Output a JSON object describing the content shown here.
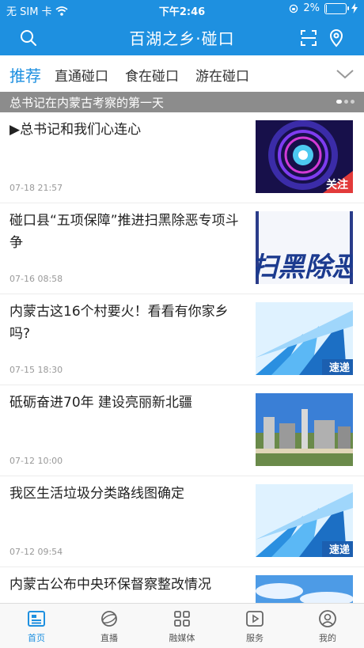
{
  "status_bar": {
    "carrier": "无 SIM 卡",
    "time": "下午2:46",
    "battery": "2%",
    "battery_level": 0.02
  },
  "header": {
    "title": "百湖之乡·碰口"
  },
  "tabs": {
    "items": [
      {
        "label": "推荐",
        "active": true
      },
      {
        "label": "直通碰口",
        "active": false
      },
      {
        "label": "食在碰口",
        "active": false
      },
      {
        "label": "游在碰口",
        "active": false
      }
    ]
  },
  "banner": {
    "text": "总书记在内蒙古考察的第一天"
  },
  "news": [
    {
      "title": "▶总书记和我们心连心",
      "date": "07-18 21:57",
      "thumb_label": "关注"
    },
    {
      "title": "碰口县“五项保障”推进扫黑除恶专项斗争",
      "date": "07-16 08:58",
      "thumb_label": "扫黑除恶"
    },
    {
      "title": "内蒙古这16个村要火！看看有你家乡吗?",
      "date": "07-15 18:30",
      "thumb_label": "速递"
    },
    {
      "title": "砥砺奋进70年 建设亮丽新北疆",
      "date": "07-12 10:00",
      "thumb_label": ""
    },
    {
      "title": "我区生活垃圾分类路线图确定",
      "date": "07-12 09:54",
      "thumb_label": "速递"
    },
    {
      "title": "内蒙古公布中央环保督察整改情况",
      "date": "",
      "thumb_label": ""
    }
  ],
  "tab_bar": {
    "items": [
      {
        "label": "首页",
        "icon": "home-icon",
        "active": true
      },
      {
        "label": "直播",
        "icon": "live-icon",
        "active": false
      },
      {
        "label": "融媒体",
        "icon": "grid-icon",
        "active": false
      },
      {
        "label": "服务",
        "icon": "play-icon",
        "active": false
      },
      {
        "label": "我的",
        "icon": "user-icon",
        "active": false
      }
    ]
  },
  "colors": {
    "primary": "#1e90e0",
    "banner_bg": "#8c8c8c"
  }
}
